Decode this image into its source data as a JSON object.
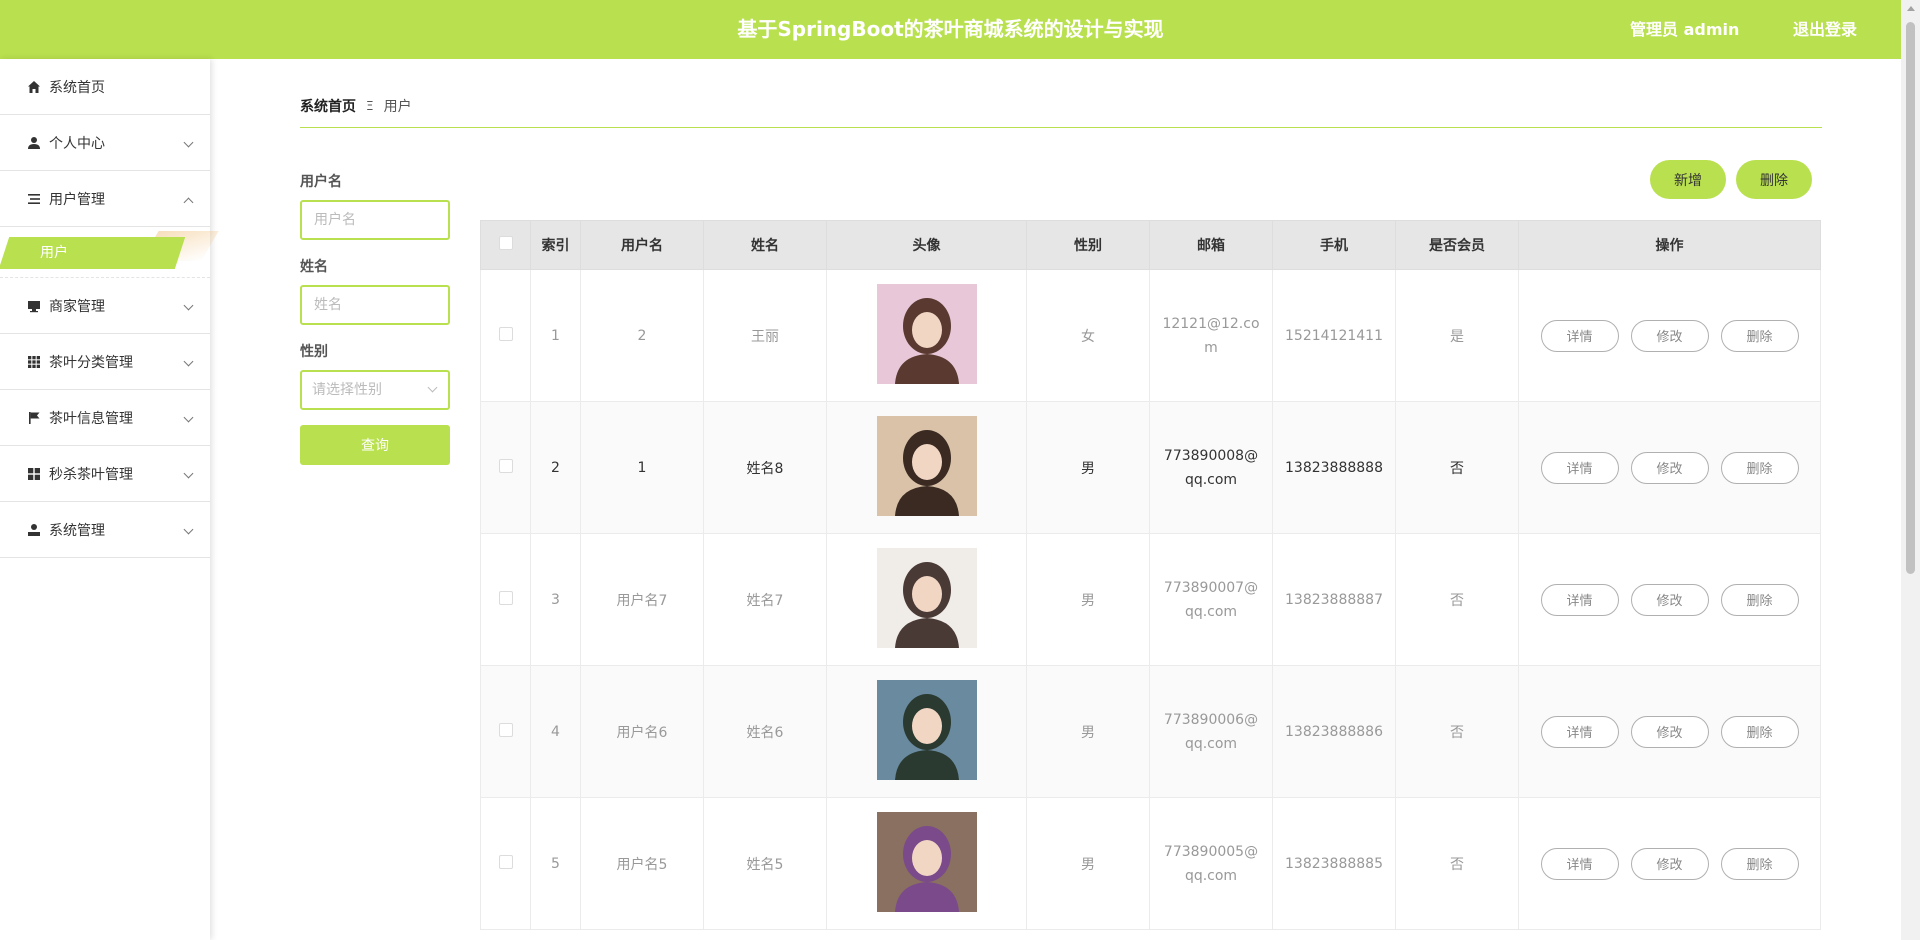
{
  "header": {
    "title": "基于SpringBoot的茶叶商城系统的设计与实现",
    "user": "管理员 admin",
    "logout": "退出登录"
  },
  "sidebar": {
    "items": [
      {
        "label": "系统首页",
        "icon": "home-icon"
      },
      {
        "label": "个人中心",
        "icon": "user-icon"
      },
      {
        "label": "用户管理",
        "icon": "list-icon"
      },
      {
        "label": "商家管理",
        "icon": "monitor-icon"
      },
      {
        "label": "茶叶分类管理",
        "icon": "grid-icon"
      },
      {
        "label": "茶叶信息管理",
        "icon": "flag-icon"
      },
      {
        "label": "秒杀茶叶管理",
        "icon": "grid-icon"
      },
      {
        "label": "系统管理",
        "icon": "person-icon"
      }
    ],
    "submenu_active": "用户"
  },
  "breadcrumb": {
    "home": "系统首页",
    "separator": "Ξ",
    "current": "用户"
  },
  "search": {
    "username_label": "用户名",
    "username_placeholder": "用户名",
    "name_label": "姓名",
    "name_placeholder": "姓名",
    "gender_label": "性别",
    "gender_placeholder": "请选择性别",
    "query_button": "查询"
  },
  "actions": {
    "add": "新增",
    "delete": "删除"
  },
  "table": {
    "headers": [
      "索引",
      "用户名",
      "姓名",
      "头像",
      "性别",
      "邮箱",
      "手机",
      "是否会员",
      "操作"
    ],
    "op_labels": {
      "detail": "详情",
      "edit": "修改",
      "delete": "删除"
    },
    "rows": [
      {
        "index": "1",
        "username": "2",
        "name": "王丽",
        "gender": "女",
        "email": "12121@12.com",
        "phone": "15214121411",
        "member": "是",
        "avatar_colors": [
          "#e8c8d8",
          "#5a3a30"
        ]
      },
      {
        "index": "2",
        "username": "1",
        "name": "姓名8",
        "gender": "男",
        "email": "773890008@qq.com",
        "phone": "13823888888",
        "member": "否",
        "avatar_colors": [
          "#d9c2a8",
          "#3a2a22"
        ]
      },
      {
        "index": "3",
        "username": "用户名7",
        "name": "姓名7",
        "gender": "男",
        "email": "773890007@qq.com",
        "phone": "13823888887",
        "member": "否",
        "avatar_colors": [
          "#f0ece8",
          "#4a3a36"
        ]
      },
      {
        "index": "4",
        "username": "用户名6",
        "name": "姓名6",
        "gender": "男",
        "email": "773890006@qq.com",
        "phone": "13823888886",
        "member": "否",
        "avatar_colors": [
          "#6a8aa0",
          "#2a3a30"
        ]
      },
      {
        "index": "5",
        "username": "用户名5",
        "name": "姓名5",
        "gender": "男",
        "email": "773890005@qq.com",
        "phone": "13823888885",
        "member": "否",
        "avatar_colors": [
          "#8a7060",
          "#7a4a8a"
        ]
      }
    ]
  },
  "colors": {
    "accent": "#b9e04f",
    "header_bg": "#b9e04f",
    "table_header_bg": "#e6e6e6"
  }
}
